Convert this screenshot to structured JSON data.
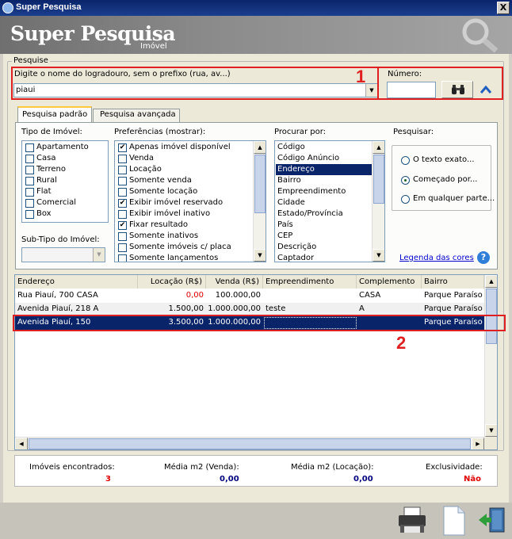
{
  "window": {
    "title": "Super Pesquisa",
    "close_label": "X"
  },
  "banner": {
    "title": "Super Pesquisa",
    "subtitle": "Imóvel"
  },
  "pesquise": {
    "group_label": "Pesquise",
    "logradouro_label": "Digite o nome do logradouro, sem o prefixo (rua, av...)",
    "logradouro_value": "piaui",
    "numero_label": "Número:",
    "numero_value": "",
    "annotation_1": "1"
  },
  "tabs": [
    {
      "label": "Pesquisa padrão"
    },
    {
      "label": "Pesquisa avançada"
    }
  ],
  "tipo_imovel": {
    "label": "Tipo de Imóvel:",
    "items": [
      {
        "label": "Apartamento",
        "checked": false
      },
      {
        "label": "Casa",
        "checked": false
      },
      {
        "label": "Terreno",
        "checked": false
      },
      {
        "label": "Rural",
        "checked": false
      },
      {
        "label": "Flat",
        "checked": false
      },
      {
        "label": "Comercial",
        "checked": false
      },
      {
        "label": "Box",
        "checked": false
      }
    ]
  },
  "sub_tipo": {
    "label": "Sub-Tipo do Imóvel:",
    "value": ""
  },
  "preferencias": {
    "label": "Preferências (mostrar):",
    "items": [
      {
        "label": "Apenas imóvel disponível",
        "checked": true
      },
      {
        "label": "Venda",
        "checked": false
      },
      {
        "label": "Locação",
        "checked": false
      },
      {
        "label": "Somente venda",
        "checked": false
      },
      {
        "label": "Somente locação",
        "checked": false
      },
      {
        "label": "Exibir imóvel reservado",
        "checked": true
      },
      {
        "label": "Exibir imóvel inativo",
        "checked": false
      },
      {
        "label": "Fixar resultado",
        "checked": true
      },
      {
        "label": "Somente inativos",
        "checked": false
      },
      {
        "label": "Somente imóveis c/ placa",
        "checked": false
      },
      {
        "label": "Somente lançamentos",
        "checked": false
      }
    ]
  },
  "procurar": {
    "label": "Procurar por:",
    "items": [
      {
        "label": "Código"
      },
      {
        "label": "Código Anúncio"
      },
      {
        "label": "Endereço",
        "selected": true
      },
      {
        "label": "Bairro"
      },
      {
        "label": "Empreendimento"
      },
      {
        "label": "Cidade"
      },
      {
        "label": "Estado/Província"
      },
      {
        "label": "País"
      },
      {
        "label": "CEP"
      },
      {
        "label": "Descrição"
      },
      {
        "label": "Captador"
      }
    ]
  },
  "pesquisar": {
    "label": "Pesquisar:",
    "options": [
      {
        "label": "O texto exato...",
        "selected": false
      },
      {
        "label": "Começado por...",
        "selected": true
      },
      {
        "label": "Em qualquer parte...",
        "selected": false
      }
    ]
  },
  "legenda_link": "Legenda das cores",
  "results": {
    "columns": [
      "Endereço",
      "Locação (R$)",
      "Venda (R$)",
      "Empreendimento",
      "Complemento",
      "Bairro"
    ],
    "rows": [
      {
        "endereco": "Rua Piauí, 700 CASA",
        "locacao": "0,00",
        "venda": "100.000,00",
        "empreendimento": "",
        "complemento": "CASA",
        "bairro": "Parque Paraíso"
      },
      {
        "endereco": "Avenida Piauí, 218 A",
        "locacao": "1.500,00",
        "venda": "1.000.000,00",
        "empreendimento": "teste",
        "complemento": "A",
        "bairro": "Parque Paraíso"
      },
      {
        "endereco": "Avenida Piauí, 150",
        "locacao": "3.500,00",
        "venda": "1.000.000,00",
        "empreendimento": "",
        "complemento": "",
        "bairro": "Parque Paraíso"
      }
    ],
    "annotation_2": "2"
  },
  "footer": {
    "encontrados_label": "Imóveis encontrados:",
    "encontrados_value": "3",
    "media_venda_label": "Média m2 (Venda):",
    "media_venda_value": "0,00",
    "media_locacao_label": "Média m2 (Locação):",
    "media_locacao_value": "0,00",
    "exclusividade_label": "Exclusividade:",
    "exclusividade_value": "Não"
  },
  "colors": {
    "accent_red": "#e02020",
    "selection": "#0a246a",
    "link": "#0000cc",
    "value_navy": "#00007f"
  },
  "icons": [
    "binoculars-icon",
    "chevron-up-icon",
    "printer-icon",
    "document-icon",
    "exit-door-icon",
    "magnifier-icon"
  ]
}
